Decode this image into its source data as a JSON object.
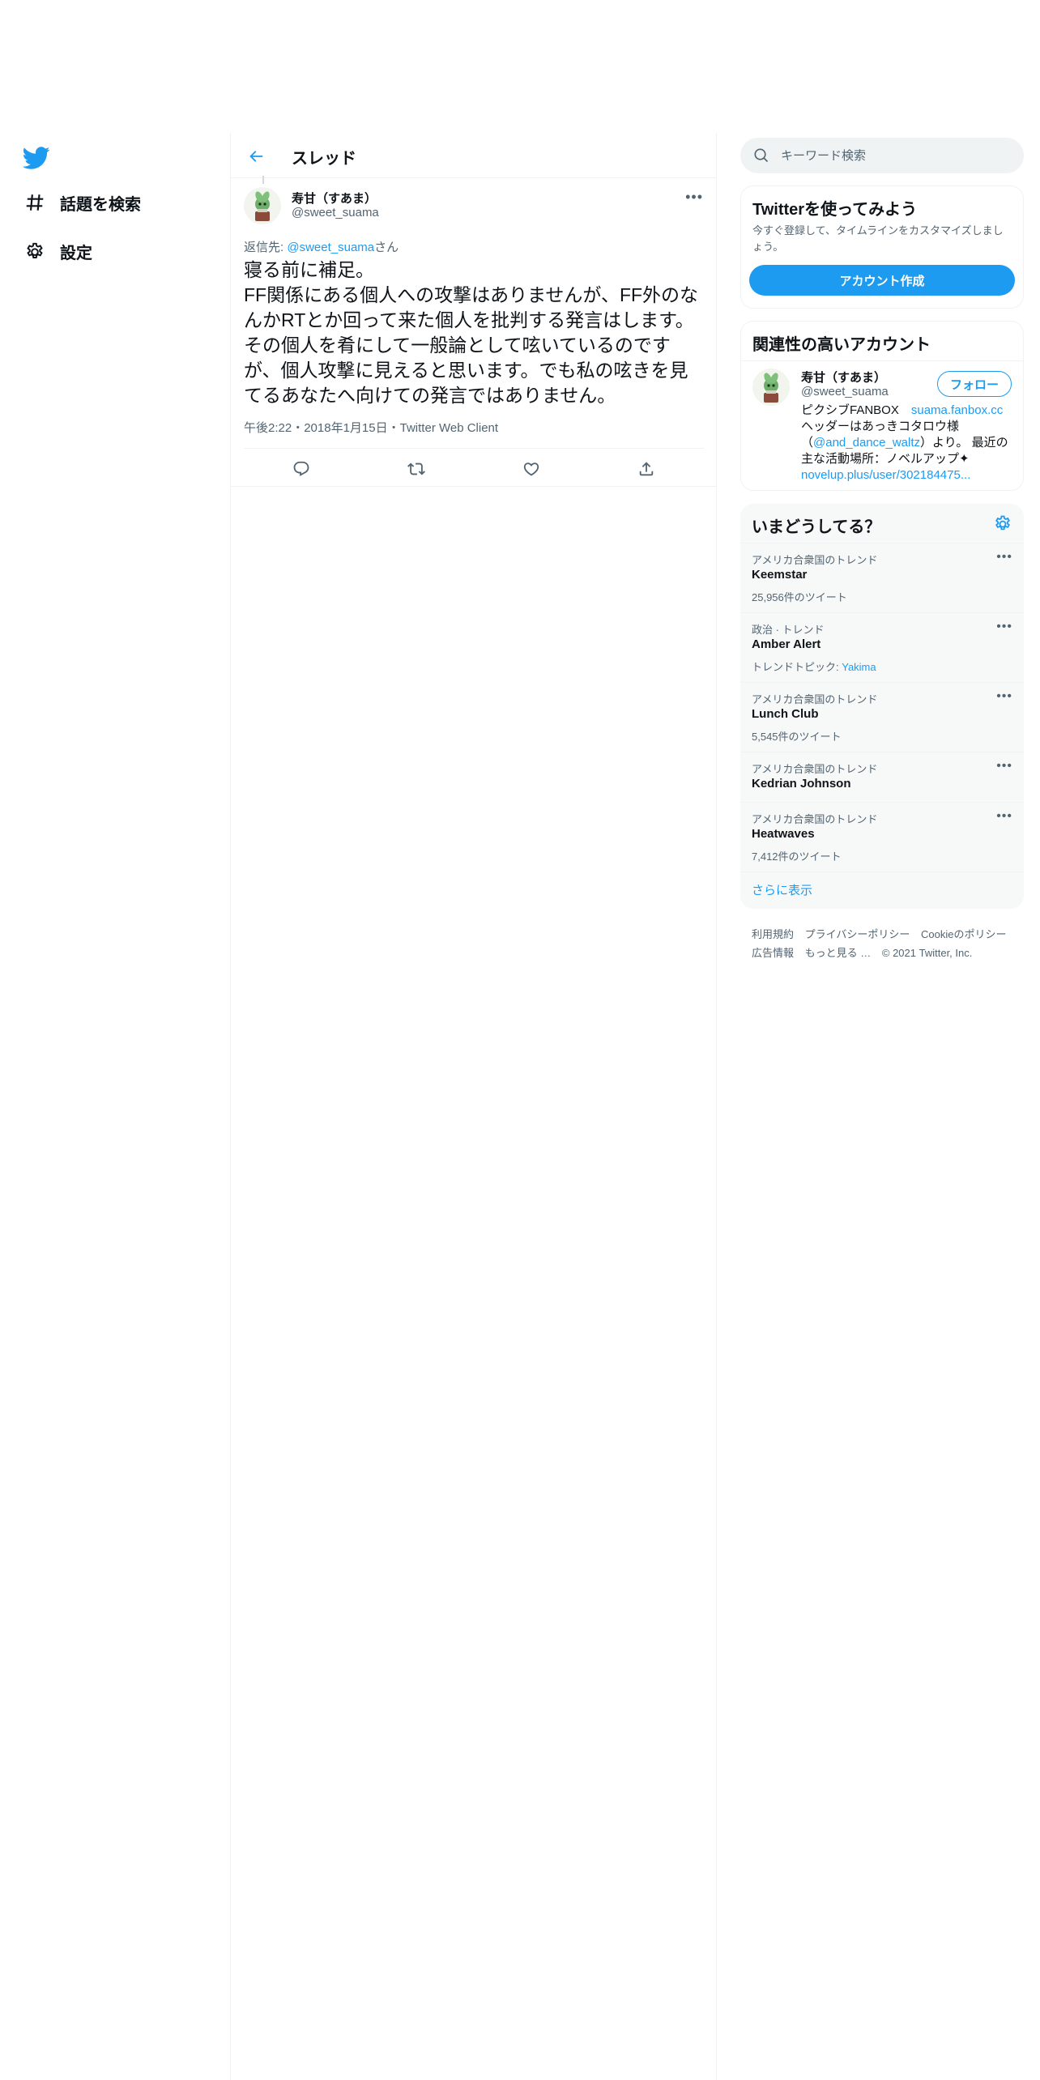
{
  "nav": {
    "logo_name": "twitter-bird-icon",
    "items": [
      {
        "icon": "hashtag-icon",
        "label": "話題を検索"
      },
      {
        "icon": "gear-icon",
        "label": "設定"
      }
    ]
  },
  "header": {
    "title": "スレッド"
  },
  "tweet": {
    "author_name": "寿甘（すあま）",
    "author_handle": "@sweet_suama",
    "reply_prefix": "返信先: ",
    "reply_handle": "@sweet_suama",
    "reply_suffix": "さん",
    "text": "寝る前に補足。\nFF関係にある個人への攻撃はありませんが、FF外のなんかRTとか回って来た個人を批判する発言はします。その個人を肴にして一般論として呟いているのですが、個人攻撃に見えると思います。でも私の呟きを見てるあなたへ向けての発言ではありません。",
    "time": "午後2:22",
    "date": "2018年1月15日",
    "client": "Twitter Web Client",
    "sep": "・"
  },
  "search": {
    "placeholder": "キーワード検索"
  },
  "signup": {
    "title": "Twitterを使ってみよう",
    "description": "今すぐ登録して、タイムラインをカスタマイズしましょう。",
    "button": "アカウント作成"
  },
  "related": {
    "title": "関連性の高いアカウント",
    "name": "寿甘（すあま）",
    "handle": "@sweet_suama",
    "follow": "フォロー",
    "bio_1": "ピクシブFANBOX　",
    "bio_link_1": "suama.fanbox.cc",
    "bio_2": "ヘッダーはあっきコタロウ様（",
    "bio_link_2": "@and_dance_waltz",
    "bio_3": "）より。 最近の主な活動場所：ノベルアップ✦　",
    "bio_link_3": "novelup.plus/user/302184475..."
  },
  "trends": {
    "title": "いまどうしてる？",
    "items": [
      {
        "context": "アメリカ合衆国のトレンド",
        "name": "Keemstar",
        "count": "25,956件のツイート"
      },
      {
        "context": "政治 · トレンド",
        "name": "Amber Alert",
        "count_prefix": "トレンドトピック: ",
        "count_link": "Yakima"
      },
      {
        "context": "アメリカ合衆国のトレンド",
        "name": "Lunch Club",
        "count": "5,545件のツイート"
      },
      {
        "context": "アメリカ合衆国のトレンド",
        "name": "Kedrian Johnson"
      },
      {
        "context": "アメリカ合衆国のトレンド",
        "name": "Heatwaves",
        "count": "7,412件のツイート"
      }
    ],
    "show_more": "さらに表示"
  },
  "footer": {
    "links": [
      "利用規約",
      "プライバシーポリシー",
      "Cookieのポリシー",
      "広告情報",
      "もっと見る …"
    ],
    "copyright": "© 2021 Twitter, Inc."
  },
  "colors": {
    "accent": "#1d9bf0",
    "text": "#0f1419",
    "muted": "#536471",
    "border": "#eff3f4"
  }
}
